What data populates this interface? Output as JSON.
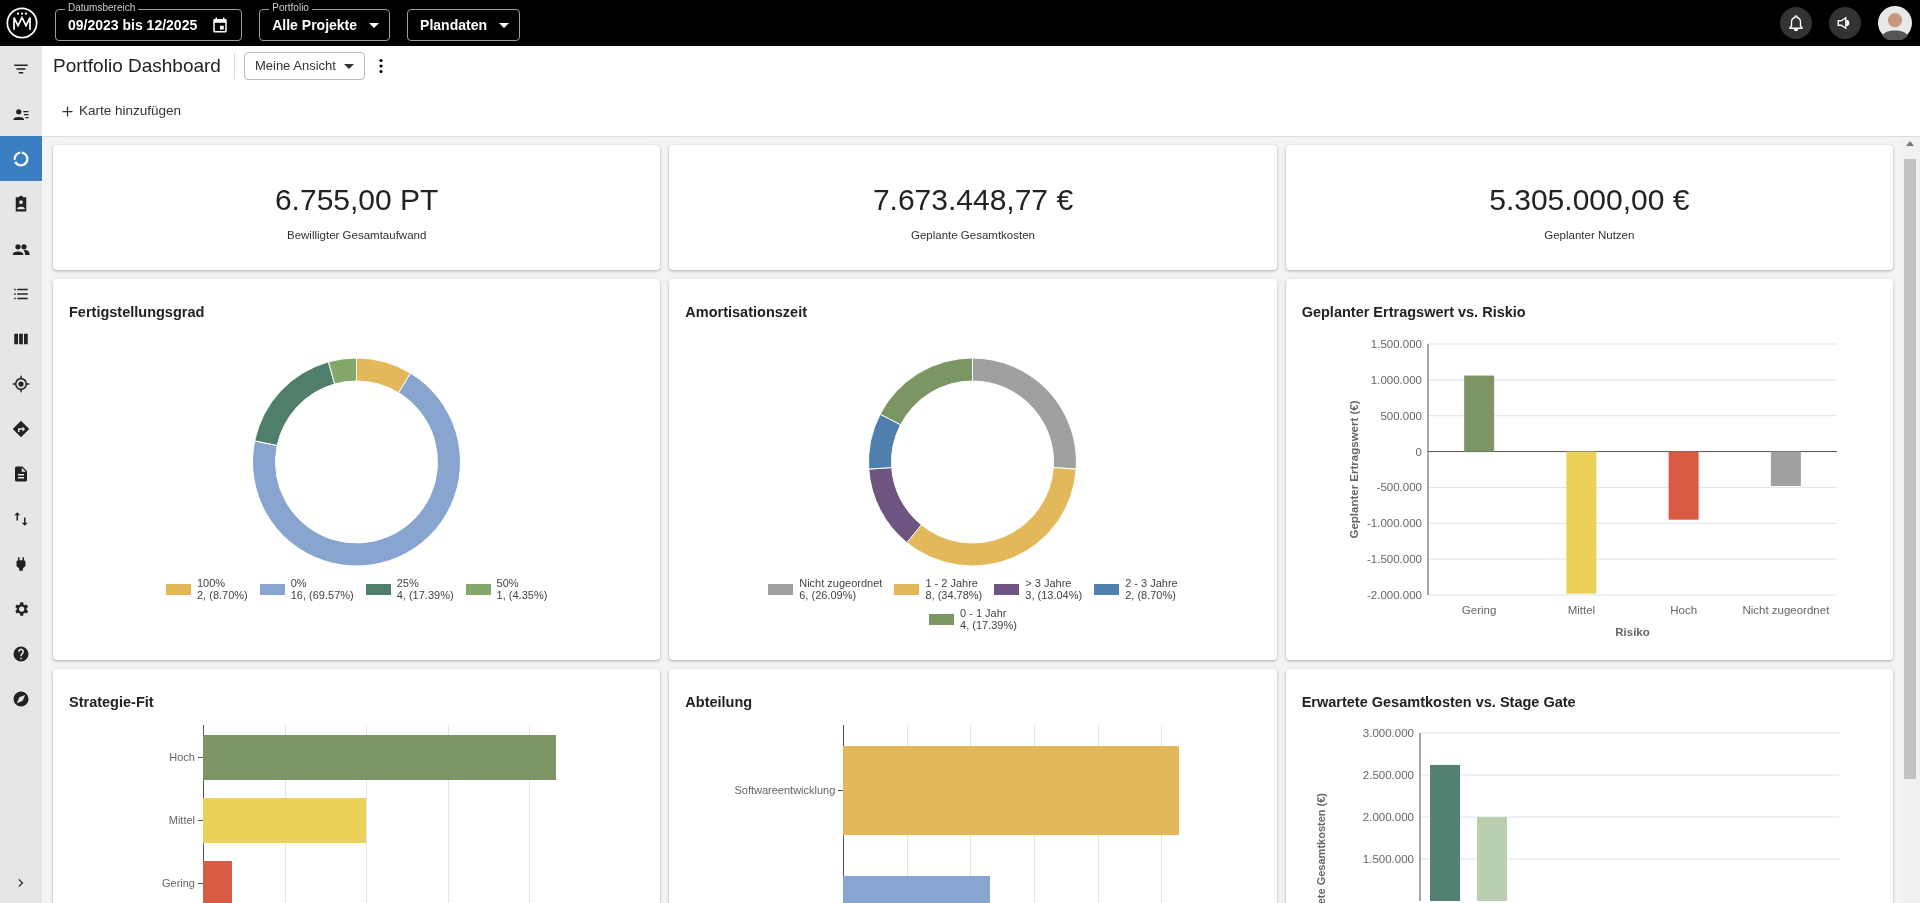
{
  "top_bar": {
    "filters": [
      {
        "kind": "date",
        "label": "Datumsbereich",
        "value": "09/2023 bis 12/2025"
      },
      {
        "kind": "select",
        "label": "Portfolio",
        "value": "Alle Projekte"
      },
      {
        "kind": "select",
        "value": "Plandaten"
      }
    ]
  },
  "sidebar": {
    "items": [
      {
        "selected": false
      },
      {
        "selected": false
      },
      {
        "selected": true
      },
      {
        "selected": false
      },
      {
        "selected": false
      },
      {
        "selected": false
      },
      {
        "selected": false
      },
      {
        "selected": false
      },
      {
        "selected": false
      },
      {
        "selected": false
      },
      {
        "selected": false
      },
      {
        "selected": false
      },
      {
        "selected": false
      },
      {
        "selected": false
      },
      {
        "selected": false
      }
    ]
  },
  "header": {
    "title": "Portfolio Dashboard",
    "view": "Meine Ansicht",
    "add_card": "Karte hinzufügen"
  },
  "kpis": [
    {
      "value": "6.755,00 PT",
      "label": "Bewilligter Gesamtaufwand"
    },
    {
      "value": "7.673.448,77 €",
      "label": "Geplante Gesamtkosten"
    },
    {
      "value": "5.305.000,00 €",
      "label": "Geplanter Nutzen"
    }
  ],
  "cards": [
    {
      "title": "Fertigstellungsgrad",
      "chart_data": {
        "type": "donut",
        "categories": [
          "100%",
          "0%",
          "25%",
          "50%"
        ],
        "values": [
          8.7,
          69.57,
          17.39,
          4.35
        ],
        "colors": [
          "#e2b85a",
          "#87a5cf",
          "#4f7f6a",
          "#84a86c"
        ]
      },
      "legend_details": [
        "2, (8.70%)",
        "16, (69.57%)",
        "4, (17.39%)",
        "1, (4.35%)"
      ]
    },
    {
      "title": "Amortisationszeit",
      "chart_data": {
        "type": "donut",
        "categories": [
          "Nicht zugeordnet",
          "1 - 2 Jahre",
          "> 3 Jahre",
          "2 - 3 Jahre",
          "0 - 1 Jahr"
        ],
        "values": [
          6,
          8,
          3,
          2,
          4
        ],
        "colors": [
          "#a0a0a0",
          "#e2b85a",
          "#6e5481",
          "#4f7fac",
          "#7b9563"
        ]
      },
      "legend_details": [
        "6, (26.09%)",
        "8, (34.78%)",
        "3, (13.04%)",
        "2, (8.70%)",
        "4, (17.39%)"
      ]
    },
    {
      "title": "Geplanter Ertragswert vs. Riskio",
      "chart_data": {
        "type": "bar",
        "grid": true,
        "xlabel": "Risiko",
        "ylabel": "Geplanter Ertragswert (€)",
        "categories": [
          "Gering",
          "Mittel",
          "Hoch",
          "Nicht zugeordnet"
        ],
        "values": [
          1060000,
          -1980000,
          -950000,
          -480000
        ],
        "colors": [
          "#7d9464",
          "#e9d15a",
          "#d95b43",
          "#a0a0a0"
        ],
        "ylim": [
          -2000000,
          1500000
        ],
        "yticks": [
          {
            "value": 1500000,
            "label": "1.500.000"
          },
          {
            "value": 1000000,
            "label": "1.000.000"
          },
          {
            "value": 500000,
            "label": "500.000"
          },
          {
            "value": 0,
            "label": "0"
          },
          {
            "value": -500000,
            "label": "-500.000"
          },
          {
            "value": -1000000,
            "label": "-1.000.000"
          },
          {
            "value": -1500000,
            "label": "-1.500.000"
          },
          {
            "value": -2000000,
            "label": "-2.000.000"
          }
        ]
      }
    },
    {
      "kind": "hbar",
      "title": "Strategie-Fit",
      "bars": [
        {
          "label": "Hoch",
          "level": 0.865,
          "color": "#7d9464"
        },
        {
          "label": "Mittel",
          "level": 0.4,
          "color": "#e9d15a"
        },
        {
          "label": "Gering",
          "level": 0.072,
          "color": "#d95b43"
        }
      ]
    },
    {
      "kind": "hbar",
      "title": "Abteilung",
      "bars": [
        {
          "label": "Softwareentwicklung",
          "level": 0.88,
          "color": "#e2b85a"
        },
        {
          "level": 0.385,
          "color": "#87a5cf"
        }
      ]
    },
    {
      "title": "Erwartete Gesamtkosten vs. Stage Gate",
      "chart_data": {
        "type": "bar",
        "grid": true,
        "ylabel": "ete Gesamtkosten (€)",
        "values": [
          2620000,
          2000000
        ],
        "colors": [
          "#548270",
          "#b9cfb0"
        ],
        "ylim": [
          1000000,
          3000000
        ],
        "yticks": [
          {
            "value": 3000000,
            "label": "3.000.000"
          },
          {
            "value": 2500000,
            "label": "2.500.000"
          },
          {
            "value": 2000000,
            "label": "2.000.000"
          },
          {
            "value": 1500000,
            "label": "1.500.000"
          }
        ]
      }
    }
  ]
}
